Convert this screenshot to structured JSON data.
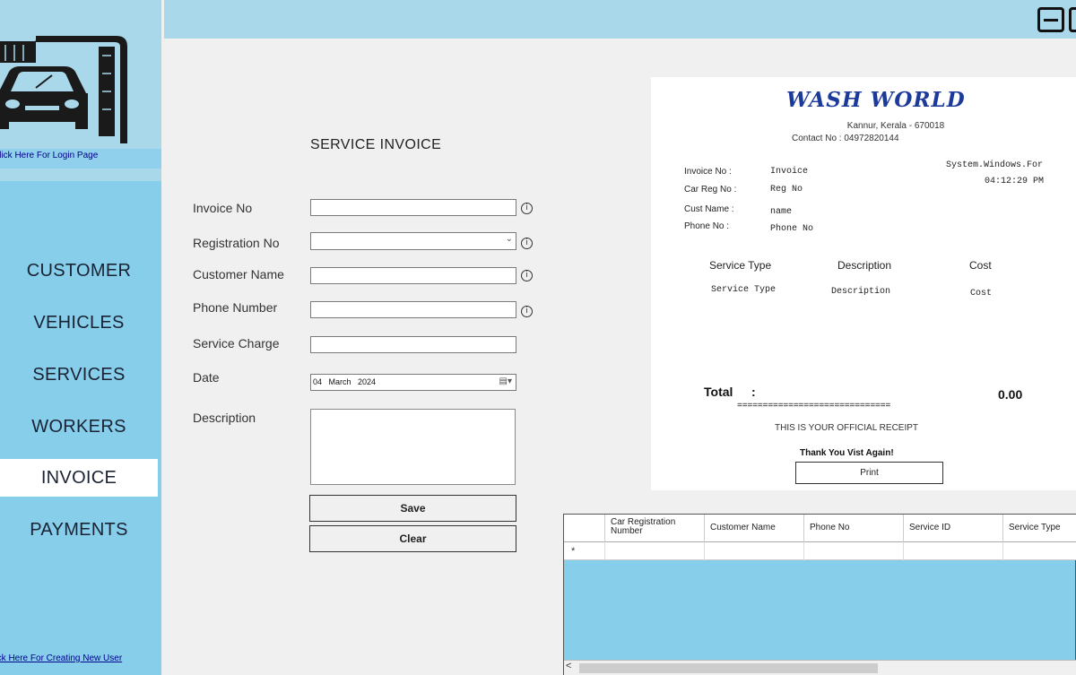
{
  "sidebar": {
    "login_link": "Click Here For Login Page",
    "new_user_link": "Click Here For Creating New User",
    "nav": [
      "CUSTOMER",
      "VEHICLES",
      "SERVICES",
      "WORKERS",
      "INVOICE",
      "PAYMENTS"
    ],
    "active": "INVOICE"
  },
  "form": {
    "title": "SERVICE INVOICE",
    "labels": {
      "invoice_no": "Invoice No",
      "registration_no": "Registration No",
      "customer_name": "Customer Name",
      "phone_number": "Phone Number",
      "service_charge": "Service Charge",
      "date": "Date",
      "description": "Description"
    },
    "values": {
      "invoice_no": "",
      "registration_no": "",
      "customer_name": "",
      "phone_number": "",
      "service_charge": "",
      "date": "04   March   2024",
      "description": ""
    },
    "buttons": {
      "save": "Save",
      "clear": "Clear"
    }
  },
  "receipt": {
    "brand": "WASH WORLD",
    "address": "Kannur, Kerala - 670018",
    "contact": "Contact No : 04972820144",
    "labels": {
      "invoice_no": "Invoice No  :",
      "car_reg_no": "Car Reg No :",
      "cust_name": "Cust Name  :",
      "phone_no": "Phone No   :"
    },
    "values": {
      "invoice_no": "Invoice",
      "car_reg_no": "Reg No",
      "cust_name": "name",
      "phone_no": "Phone No"
    },
    "date_text": "System.Windows.For",
    "time_text": "04:12:29 PM",
    "columns": [
      "Service Type",
      "Description",
      "Cost"
    ],
    "row": [
      "Service Type",
      "Description",
      "Cost"
    ],
    "total_label": "Total",
    "total_colon": ":",
    "total_value": "0.00",
    "divider": "==============================",
    "official": "THIS IS YOUR OFFICIAL RECEIPT",
    "thanks": "Thank You Vist Again!",
    "print": "Print"
  },
  "grid": {
    "columns": [
      "Car Registration Number",
      "Customer Name",
      "Phone No",
      "Service ID",
      "Service Type"
    ],
    "new_row_marker": "*",
    "scroll_left": "<"
  },
  "colors": {
    "sidebar": "#87ceeb",
    "topbar": "#a8d8ea",
    "brand": "#1c3a9a"
  }
}
